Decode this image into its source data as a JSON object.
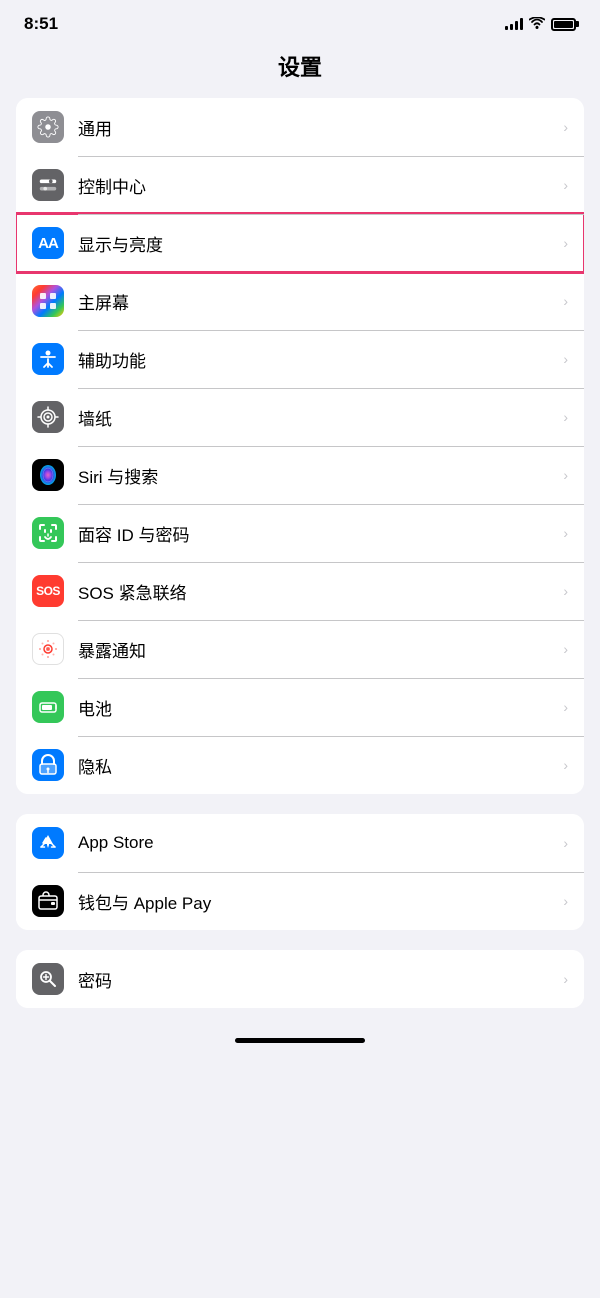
{
  "statusBar": {
    "time": "8:51",
    "signal": "4 bars",
    "wifi": "on",
    "battery": "full"
  },
  "pageTitle": "设置",
  "group1": {
    "items": [
      {
        "id": "tongyong",
        "label": "通用",
        "iconBg": "bg-gray",
        "iconType": "gear",
        "highlighted": false
      },
      {
        "id": "kongzhizhongxin",
        "label": "控制中心",
        "iconBg": "bg-gray2",
        "iconType": "toggle",
        "highlighted": false
      },
      {
        "id": "xianshiyuliangdu",
        "label": "显示与亮度",
        "iconBg": "bg-blue",
        "iconType": "aa",
        "highlighted": true
      },
      {
        "id": "zhupingmu",
        "label": "主屏幕",
        "iconBg": "bg-rainbow",
        "iconType": "grid",
        "highlighted": false
      },
      {
        "id": "fuzhugongneng",
        "label": "辅助功能",
        "iconBg": "bg-blue-light",
        "iconType": "accessibility",
        "highlighted": false
      },
      {
        "id": "qiangzhi",
        "label": "墙纸",
        "iconBg": "bg-gray",
        "iconType": "flower",
        "highlighted": false
      },
      {
        "id": "siri",
        "label": "Siri 与搜索",
        "iconBg": "bg-siri",
        "iconType": "siri",
        "highlighted": false
      },
      {
        "id": "faceid",
        "label": "面容 ID 与密码",
        "iconBg": "bg-faceid",
        "iconType": "faceid",
        "highlighted": false
      },
      {
        "id": "sos",
        "label": "SOS 紧急联络",
        "iconBg": "bg-sos",
        "iconType": "sos",
        "highlighted": false
      },
      {
        "id": "baolu",
        "label": "暴露通知",
        "iconBg": "bg-exposure",
        "iconType": "exposure",
        "highlighted": false
      },
      {
        "id": "dianchi",
        "label": "电池",
        "iconBg": "bg-battery",
        "iconType": "battery",
        "highlighted": false
      },
      {
        "id": "yinsi",
        "label": "隐私",
        "iconBg": "bg-privacy",
        "iconType": "privacy",
        "highlighted": false
      }
    ]
  },
  "group2": {
    "items": [
      {
        "id": "appstore",
        "label": "App Store",
        "iconBg": "bg-appstore",
        "iconType": "appstore",
        "highlighted": false
      },
      {
        "id": "wallet",
        "label": "钱包与 Apple Pay",
        "iconBg": "bg-wallet",
        "iconType": "wallet",
        "highlighted": false
      }
    ]
  },
  "group3": {
    "items": [
      {
        "id": "password",
        "label": "密码",
        "iconBg": "bg-password",
        "iconType": "password",
        "highlighted": false
      }
    ]
  },
  "chevron": "›"
}
